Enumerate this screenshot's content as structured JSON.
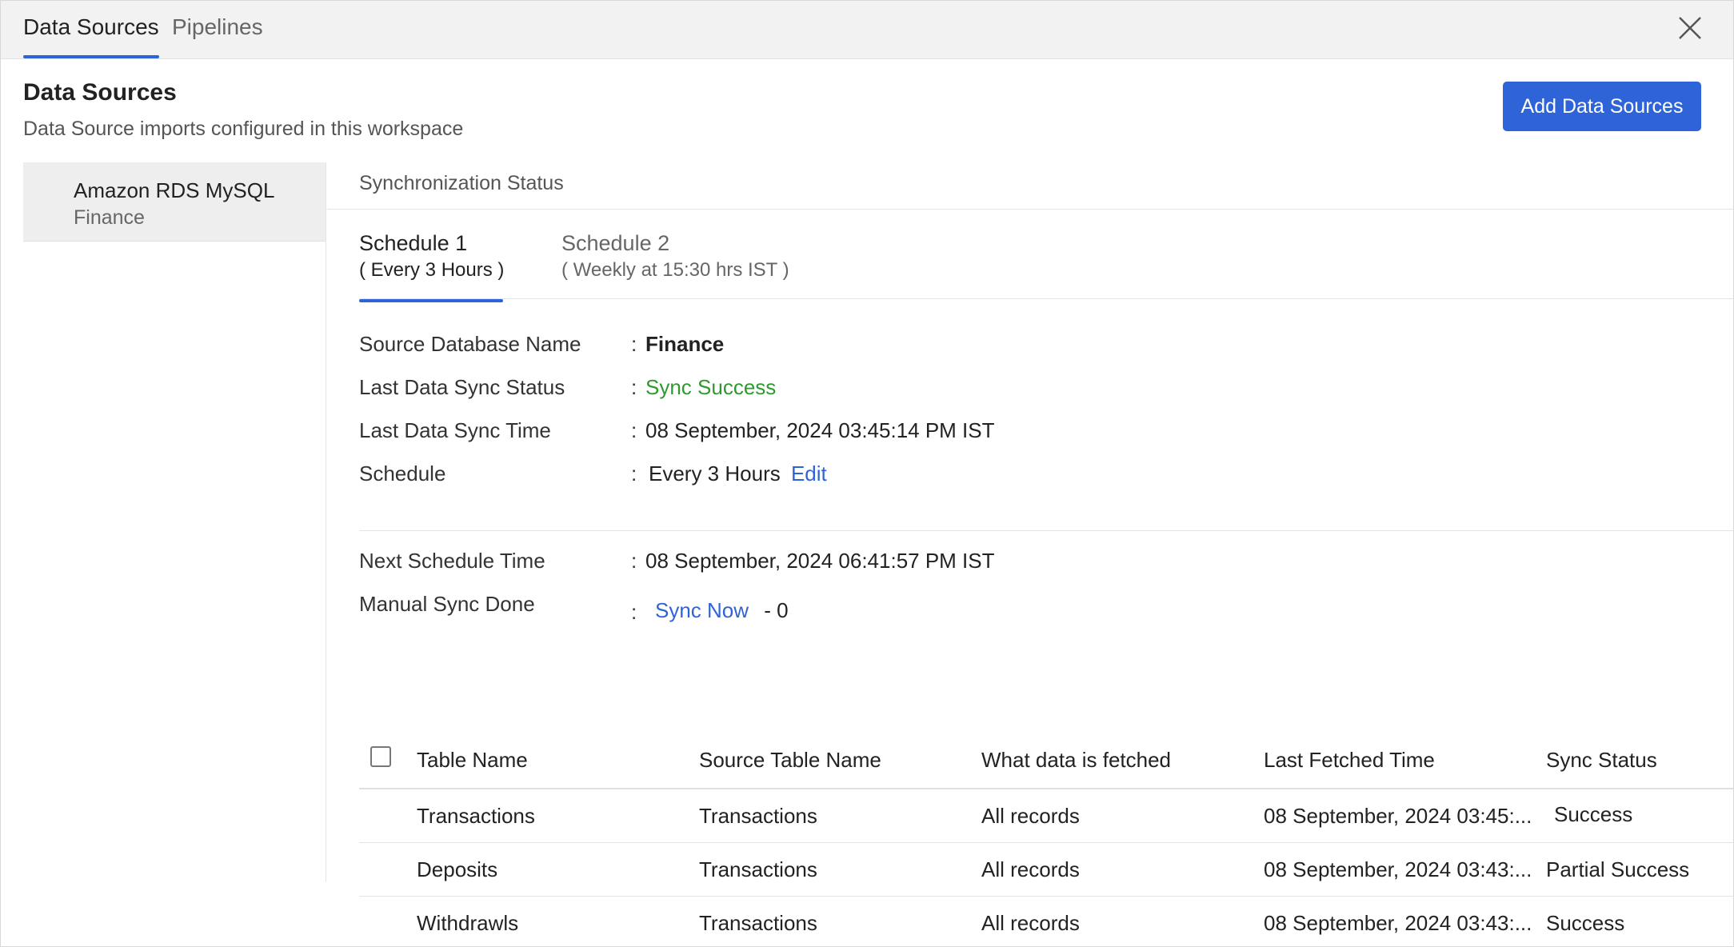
{
  "top_tabs": [
    {
      "label": "Data Sources",
      "active": true
    },
    {
      "label": "Pipelines",
      "active": false
    }
  ],
  "header": {
    "title": "Data Sources",
    "subtitle": "Data Source imports configured in this workspace",
    "add_button": "Add Data Sources"
  },
  "data_sources": [
    {
      "name": "Amazon RDS MySQL",
      "database": "Finance"
    }
  ],
  "sync_section_label": "Synchronization Status",
  "schedule_tabs": [
    {
      "title": "Schedule 1",
      "subtitle": "( Every 3 Hours )",
      "active": true
    },
    {
      "title": "Schedule 2",
      "subtitle": "( Weekly at 15:30 hrs IST )",
      "active": false
    }
  ],
  "info": {
    "source_db_label": "Source Database Name",
    "source_db_value": "Finance",
    "last_sync_status_label": "Last Data Sync Status",
    "last_sync_status_value": "Sync Success",
    "last_sync_time_label": "Last Data Sync Time",
    "last_sync_time_value": "08 September, 2024 03:45:14 PM IST",
    "schedule_label": "Schedule",
    "schedule_value": "Every 3 Hours",
    "edit_link": "Edit",
    "next_schedule_label": "Next Schedule Time",
    "next_schedule_value": "08 September, 2024 06:41:57 PM IST",
    "manual_sync_label": "Manual Sync Done",
    "sync_now_link": "Sync Now",
    "manual_sync_count": "- 0",
    "colon": ":"
  },
  "table": {
    "columns": [
      "Table Name",
      "Source Table Name",
      "What data is fetched",
      "Last Fetched Time",
      "Sync Status"
    ],
    "rows": [
      {
        "table_name": "Transactions",
        "source_table": "Transactions",
        "data_fetched": "All records",
        "last_fetched": "08 September, 2024 03:45:...",
        "status": "Success"
      },
      {
        "table_name": "Deposits",
        "source_table": "Transactions",
        "data_fetched": "All records",
        "last_fetched": "08 September, 2024 03:43:...",
        "status": "Partial Success"
      },
      {
        "table_name": "Withdrawls",
        "source_table": "Transactions",
        "data_fetched": "All records",
        "last_fetched": "08 September, 2024 03:43:...",
        "status": "Success"
      }
    ]
  },
  "colors": {
    "accent": "#2f64d8",
    "success": "#2e9a2e"
  },
  "icons": {
    "close": "close-icon"
  }
}
